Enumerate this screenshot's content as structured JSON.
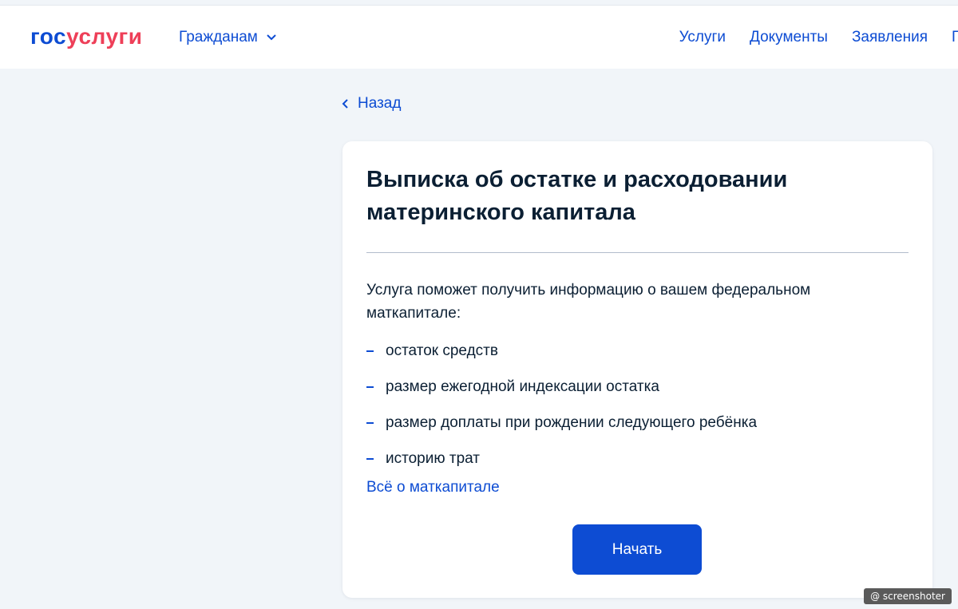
{
  "header": {
    "logo_part1": "гос",
    "logo_part2": "услуги",
    "citizens_label": "Гражданам",
    "nav": [
      "Услуги",
      "Документы",
      "Заявления",
      "Г"
    ]
  },
  "back_label": "Назад",
  "card": {
    "title": "Выписка об остатке и расходовании материнского капитала",
    "intro": "Услуга поможет получить информацию о вашем федеральном маткапитале:",
    "items": [
      "остаток средств",
      "размер ежегодной индексации остатка",
      "размер доплаты при рождении следующего ребёнка",
      "историю трат"
    ],
    "more_link": "Всё о маткапитале",
    "start_button": "Начать"
  },
  "watermark": "@ screenshoter",
  "colors": {
    "accent": "#0d4cd3",
    "logo_red": "#ee3f58",
    "background": "#f1f5f9",
    "text": "#0b1f33"
  }
}
